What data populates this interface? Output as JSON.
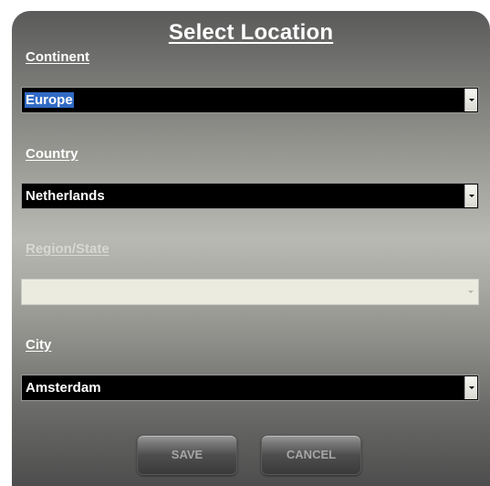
{
  "dialog": {
    "title": "Select Location"
  },
  "fields": {
    "continent": {
      "label": "Continent",
      "value": "Europe"
    },
    "country": {
      "label": "Country",
      "value": "Netherlands"
    },
    "region": {
      "label": "Region/State",
      "value": ""
    },
    "city": {
      "label": "City",
      "value": "Amsterdam"
    }
  },
  "buttons": {
    "save": "SAVE",
    "cancel": "CANCEL"
  },
  "icons": {
    "dropdown": "chevron-down-icon"
  },
  "colors": {
    "selection": "#316ac5",
    "select_background": "#000000",
    "disabled_select_background": "#ecebe0"
  }
}
